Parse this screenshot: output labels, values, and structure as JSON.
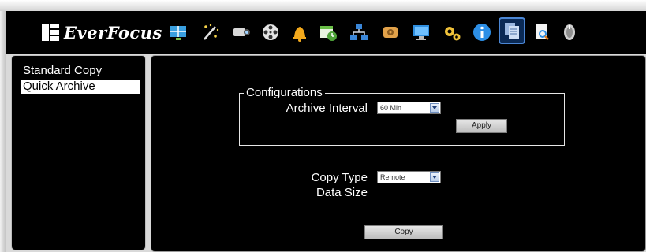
{
  "brand": {
    "name": "EverFocus"
  },
  "toolbar": {
    "icons": [
      "live-view-icon",
      "magic-wand-icon",
      "camera-icon",
      "film-reel-icon",
      "bell-icon",
      "calendar-schedule-icon",
      "network-icon",
      "disk-icon",
      "monitor-icon",
      "gears-icon",
      "info-icon",
      "copy-icon",
      "search-log-icon",
      "shutdown-icon"
    ],
    "active_icon": "copy-icon"
  },
  "sidebar": {
    "items": [
      {
        "label": "Standard Copy",
        "selected": false
      },
      {
        "label": "Quick Archive",
        "selected": true
      }
    ]
  },
  "main": {
    "configurations": {
      "legend": "Configurations",
      "archive_interval_label": "Archive Interval",
      "archive_interval_value": "60 Min",
      "apply_label": "Apply"
    },
    "copy_type_label": "Copy Type",
    "copy_type_value": "Remote",
    "data_size_label": "Data Size",
    "copy_label": "Copy"
  },
  "colors": {
    "background": "#000000",
    "accent": "#4b86d4",
    "selected_bg": "#ffffff"
  }
}
